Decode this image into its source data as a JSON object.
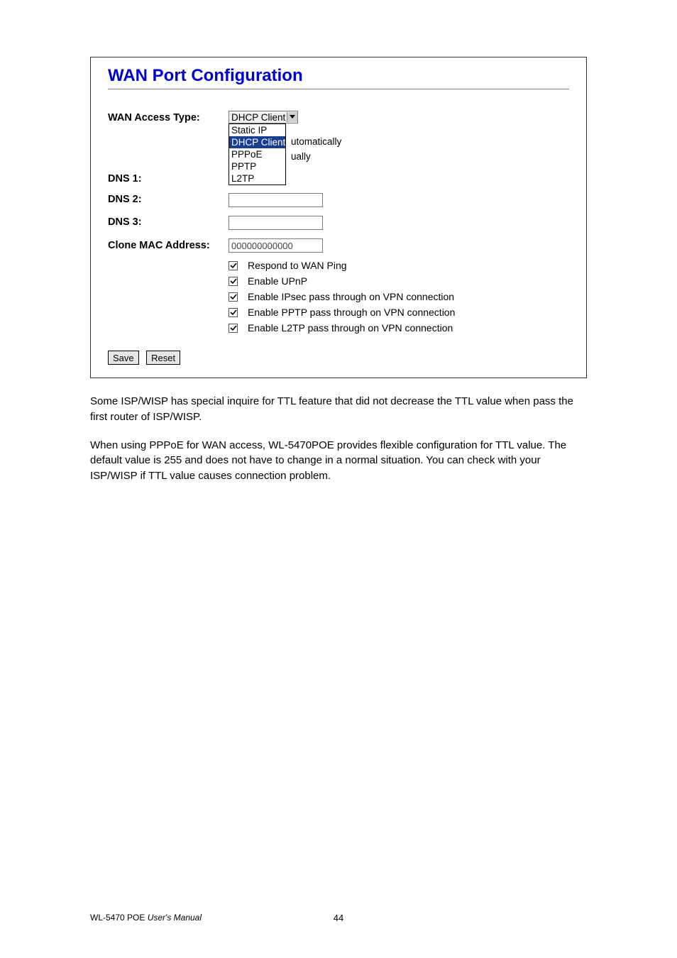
{
  "panel": {
    "title": "WAN Port Configuration",
    "wanAccessLabel": "WAN Access Type:",
    "wanAccessSelected": "DHCP Client",
    "wanAccessOptions": [
      "Static IP",
      "DHCP Client",
      "PPPoE",
      "PPTP",
      "L2TP"
    ],
    "suffix1": "utomatically",
    "suffix2": "ually",
    "dns1Label": "DNS 1:",
    "dns2Label": "DNS 2:",
    "dns3Label": "DNS 3:",
    "dns1Value": "",
    "dns2Value": "",
    "dns3Value": "",
    "cloneMacLabel": "Clone MAC Address:",
    "cloneMacValue": "000000000000",
    "checks": [
      {
        "label": "Respond to WAN Ping",
        "checked": true
      },
      {
        "label": "Enable UPnP",
        "checked": true
      },
      {
        "label": "Enable IPsec pass through on VPN connection",
        "checked": true
      },
      {
        "label": "Enable PPTP pass through on VPN connection",
        "checked": true
      },
      {
        "label": "Enable L2TP pass through on VPN connection",
        "checked": true
      }
    ],
    "saveLabel": "Save",
    "resetLabel": "Reset"
  },
  "body": {
    "p1": "Some ISP/WISP has special inquire for TTL feature that did not decrease the TTL value when pass the first router of ISP/WISP.",
    "p2": "When using PPPoE for WAN access, WL-5470POE provides flexible configuration for TTL value. The default value is 255 and does not have to change in a normal situation. You can check with your ISP/WISP if TTL value causes connection problem."
  },
  "footer": {
    "left_product": "WL-5470 POE ",
    "left_italic": "User's Manual",
    "pageNum": "44"
  }
}
